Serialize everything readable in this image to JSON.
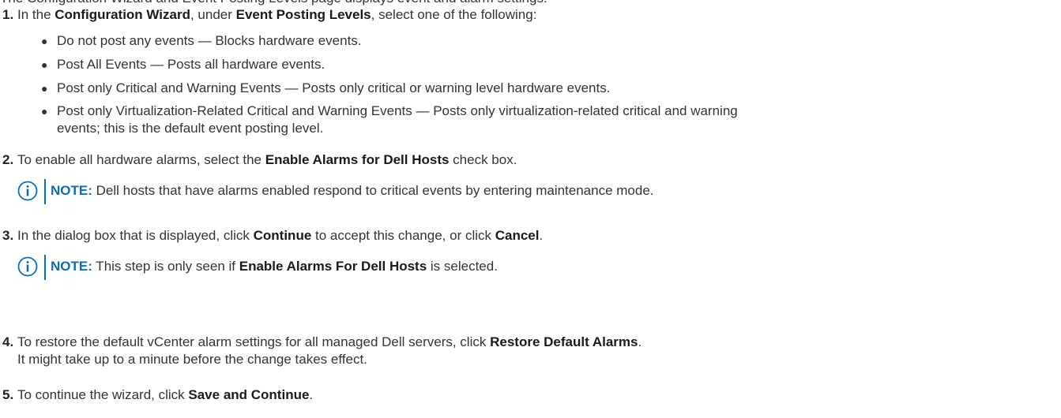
{
  "top_cut_text": "The Configuration Wizard and Event Posting Levels page displays event and alarm settings.",
  "steps": [
    {
      "num": "1.",
      "pre": "In the ",
      "b1": "Configuration Wizard",
      "mid": ", under ",
      "b2": "Event Posting Levels",
      "post": ", select one of the following:"
    },
    {
      "num": "2.",
      "pre": "To enable all hardware alarms, select the ",
      "b1": "Enable Alarms for Dell Hosts",
      "post": " check box."
    },
    {
      "num": "3.",
      "pre": "In the dialog box that is displayed, click ",
      "b1": "Continue",
      "mid": " to accept this change, or click ",
      "b2": "Cancel",
      "post": "."
    },
    {
      "num": "4.",
      "pre": "To restore the default vCenter alarm settings for all managed Dell servers, click ",
      "b1": "Restore Default Alarms",
      "post": ".",
      "line2": "It might take up to a minute before the change takes effect."
    },
    {
      "num": "5.",
      "pre": "To continue the wizard, click ",
      "b1": "Save and Continue",
      "post": "."
    }
  ],
  "bullets": [
    {
      "text": "Do not post any events — Blocks hardware events."
    },
    {
      "text": "Post All Events — Posts all hardware events."
    },
    {
      "text": "Post only Critical and Warning Events — Posts only critical or warning level hardware events."
    },
    {
      "line1": "Post only Virtualization-Related Critical and Warning Events — Posts only virtualization-related critical and warning",
      "line2": "events; this is the default event posting level."
    }
  ],
  "bullet_glyph": "●",
  "notes": [
    {
      "label": "NOTE:",
      "text": " Dell hosts that have alarms enabled respond to critical events by entering maintenance mode."
    },
    {
      "label": "NOTE:",
      "pre": " This step is only seen if ",
      "bold": "Enable Alarms For Dell Hosts",
      "post": " is selected."
    }
  ],
  "note_icon": "info-circle-icon",
  "accent_color": "#0b6fb8"
}
